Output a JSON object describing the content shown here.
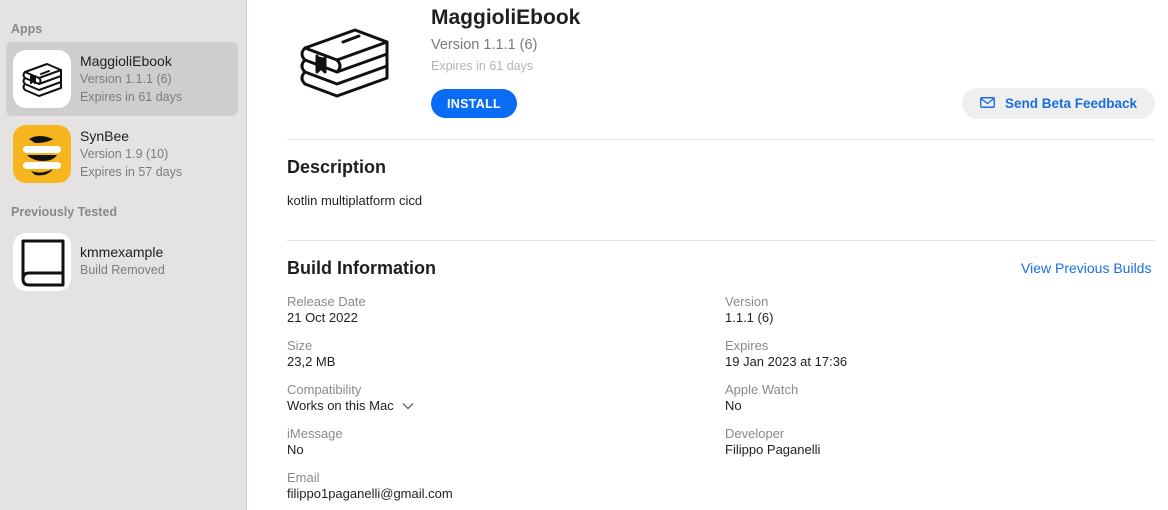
{
  "sidebar": {
    "apps_label": "Apps",
    "previously_label": "Previously Tested",
    "apps": [
      {
        "name": "MaggioliEbook",
        "version": "Version 1.1.1 (6)",
        "expires": "Expires in 61 days",
        "icon": "books-stack-icon"
      },
      {
        "name": "SynBee",
        "version": "Version 1.9 (10)",
        "expires": "Expires in 57 days",
        "icon": "synbee-logo-icon"
      }
    ],
    "previous": [
      {
        "name": "kmmexample",
        "status": "Build Removed",
        "icon": "book-icon"
      }
    ]
  },
  "header": {
    "title": "MaggioliEbook",
    "version": "Version 1.1.1 (6)",
    "expires": "Expires in 61 days",
    "install_label": "INSTALL",
    "feedback_label": "Send Beta Feedback"
  },
  "description": {
    "heading": "Description",
    "text": "kotlin multiplatform cicd"
  },
  "build_info": {
    "heading": "Build Information",
    "view_previous_label": "View Previous Builds",
    "left": [
      {
        "label": "Release Date",
        "value": "21 Oct 2022"
      },
      {
        "label": "Size",
        "value": "23,2 MB"
      },
      {
        "label": "Compatibility",
        "value": "Works on this Mac"
      },
      {
        "label": "iMessage",
        "value": "No"
      },
      {
        "label": "Email",
        "value": "filippo1paganelli@gmail.com"
      }
    ],
    "right": [
      {
        "label": "Version",
        "value": "1.1.1 (6)"
      },
      {
        "label": "Expires",
        "value": "19 Jan 2023 at 17:36"
      },
      {
        "label": "Apple Watch",
        "value": "No"
      },
      {
        "label": "Developer",
        "value": "Filippo Paganelli"
      }
    ]
  },
  "colors": {
    "accent": "#0a6cf5",
    "link": "#1a6fe0",
    "sidebar_bg": "#e4e3e2",
    "selected_row": "#cfcecd",
    "synbee_yellow": "#f6b51e"
  }
}
